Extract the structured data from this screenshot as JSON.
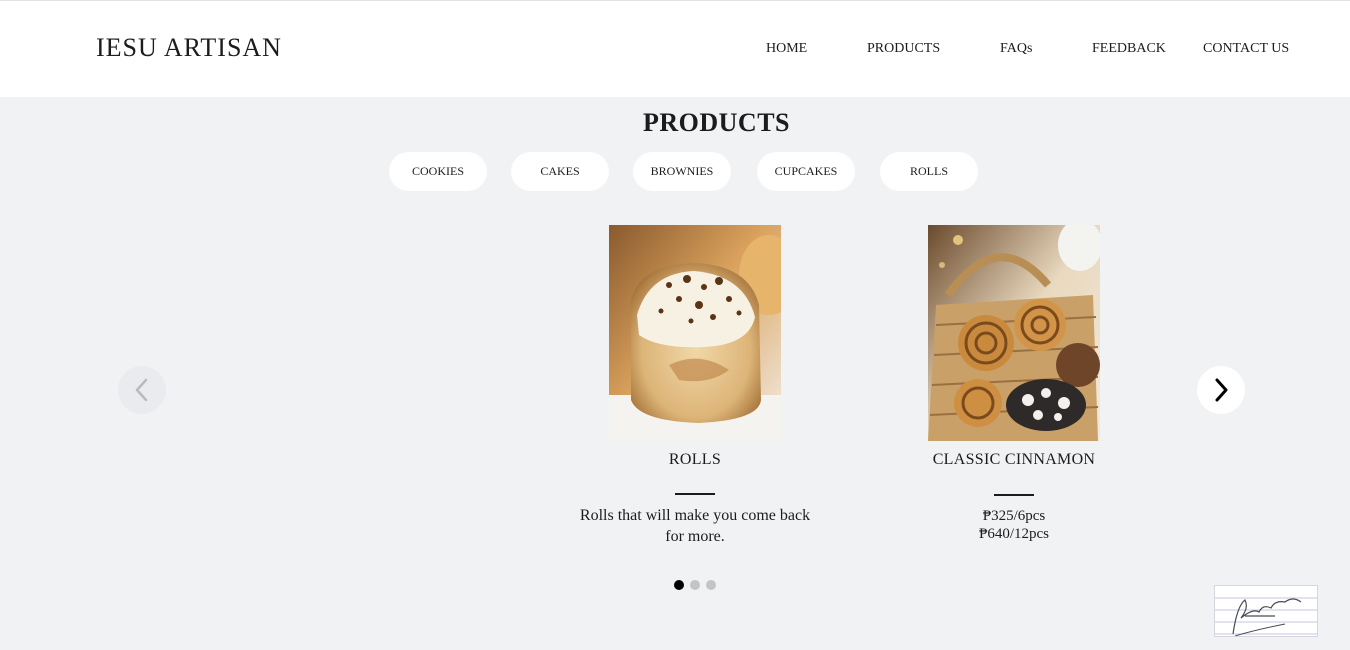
{
  "brand": "IESU ARTISAN",
  "nav": {
    "home": "HOME",
    "products": "PRODUCTS",
    "faqs": "FAQs",
    "feedback": "FEEDBACK",
    "contact": "CONTACT US"
  },
  "products_section": {
    "title": "PRODUCTS",
    "categories": [
      "COOKIES",
      "CAKES",
      "BROWNIES",
      "CUPCAKES",
      "ROLLS"
    ]
  },
  "carousel": {
    "cards": [
      {
        "title": "ROLLS",
        "text": "Rolls that will make you come back for more."
      },
      {
        "title": "CLASSIC CINNAMON",
        "prices": [
          "₱325/6pcs",
          "₱640/12pcs"
        ]
      }
    ],
    "pagination": {
      "pages": 3,
      "active": 1
    },
    "prev_icon": "chevron-left-icon",
    "next_icon": "chevron-right-icon"
  },
  "colors": {
    "page_bg": "#f1f2f4",
    "header_bg": "#ffffff",
    "text": "#1c1c1c",
    "dot_active": "#000000",
    "dot_inactive": "#c4c4c4"
  }
}
